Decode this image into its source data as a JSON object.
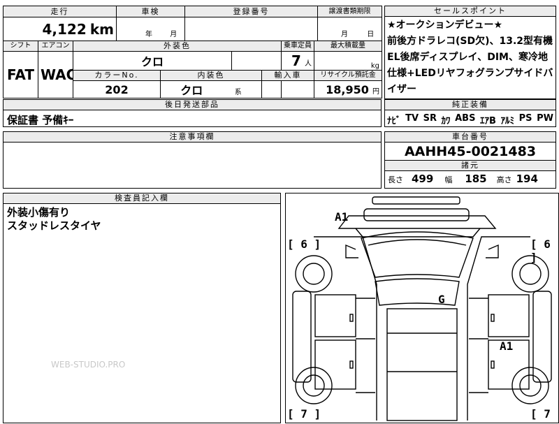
{
  "header": {
    "mileage_label": "走行",
    "inspection_label": "車検",
    "registration_label": "登録番号",
    "transfer_deadline_label": "譲渡書類期限"
  },
  "values": {
    "mileage": "4,122",
    "mileage_unit": "km",
    "inspection_year_unit": "年",
    "inspection_month_unit": "月",
    "transfer_month_unit": "月",
    "transfer_day_unit": "日"
  },
  "spec_labels": {
    "shift": "シフト",
    "aircon": "エアコン",
    "exterior_color": "外装色",
    "capacity": "乗車定員",
    "max_load": "最大積載量",
    "color_no": "カラーNo.",
    "interior_color": "内装色",
    "import": "輸入車",
    "recycle": "リサイクル預託金"
  },
  "spec": {
    "shift": "FAT",
    "aircon": "WAC",
    "exterior_color": "クロ",
    "capacity": "7",
    "capacity_unit": "人",
    "max_load_unit": "kg",
    "color_no": "202",
    "interior_color": "クロ",
    "interior_suffix": "系",
    "recycle_fee": "18,950",
    "recycle_unit": "円"
  },
  "later_parts": {
    "label": "後日発送部品",
    "value": "保証書 予備ｷｰ"
  },
  "caution": {
    "label": "注意事項欄",
    "value": ""
  },
  "selling_points": {
    "label": "セールスポイント",
    "text": "★オークションデビュー★\n前後方ドラレコ(SD欠)、13.2型有機EL後席ディスプレイ、DIM、寒冷地仕様+LEDリヤフォグランプサイドバイザー"
  },
  "equipment": {
    "label": "純正装備",
    "items": [
      "ﾅﾋﾞ",
      "TV",
      "SR",
      "ｶﾜ",
      "ABS",
      "ｴｱB",
      "ｱﾙﾐ",
      "PS",
      "PW"
    ]
  },
  "chassis": {
    "label": "車台番号",
    "number": "AAHH45-0021483"
  },
  "dimensions": {
    "label": "諸元",
    "length_label": "長さ",
    "length": "499",
    "width_label": "幅",
    "width": "185",
    "height_label": "高さ",
    "height": "194"
  },
  "inspector": {
    "label": "検査員記入欄",
    "notes": "外装小傷有り\nスタッドレスタイヤ"
  },
  "diagram": {
    "tire_left_front": "[ 6 ]",
    "tire_right_front": "[ 6 ]",
    "tire_left_rear": "[ 7 ]",
    "tire_right_rear": "[ 7",
    "mark_front": "A1",
    "mark_roof": "G",
    "mark_right_side": "A1"
  },
  "watermark": "WEB-STUDIO.PRO"
}
